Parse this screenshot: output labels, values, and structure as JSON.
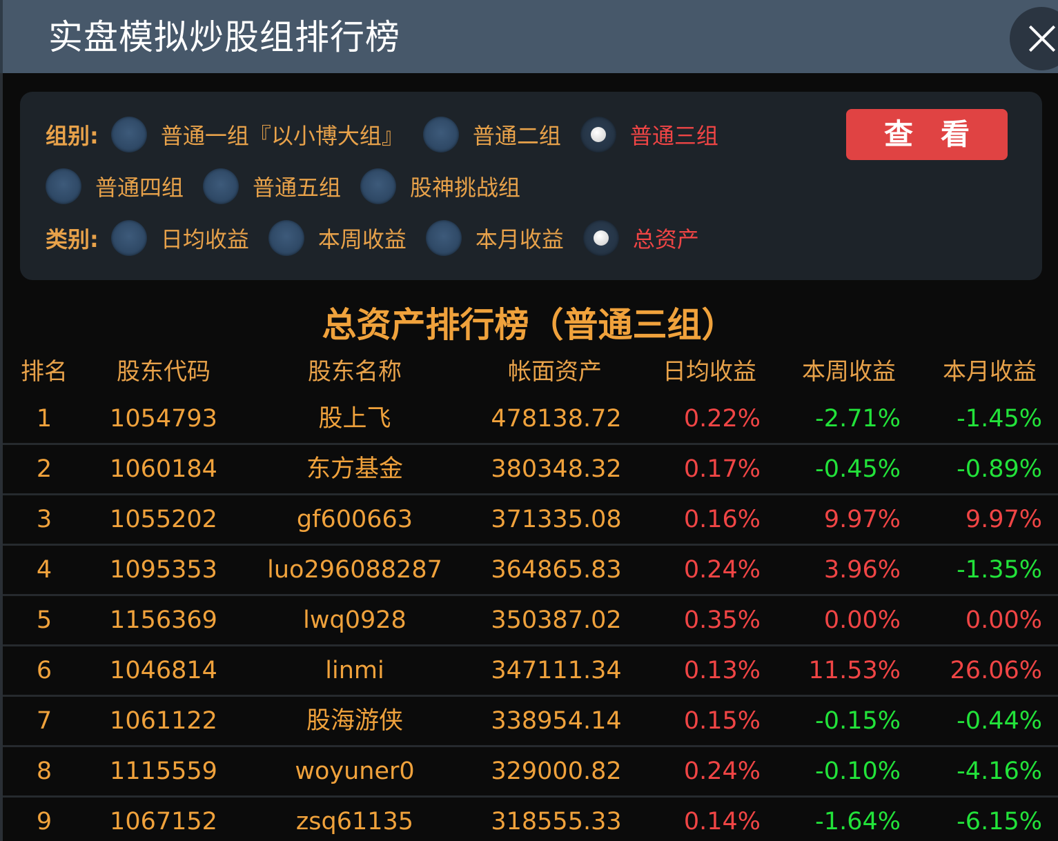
{
  "window": {
    "title": "实盘模拟炒股组排行榜"
  },
  "filters": {
    "group_label": "组别:",
    "groups": [
      {
        "label": "普通一组『以小博大组』",
        "checked": false
      },
      {
        "label": "普通二组",
        "checked": false
      },
      {
        "label": "普通三组",
        "checked": true
      },
      {
        "label": "普通四组",
        "checked": false
      },
      {
        "label": "普通五组",
        "checked": false
      },
      {
        "label": "股神挑战组",
        "checked": false
      }
    ],
    "category_label": "类别:",
    "categories": [
      {
        "label": "日均收益",
        "checked": false
      },
      {
        "label": "本周收益",
        "checked": false
      },
      {
        "label": "本月收益",
        "checked": false
      },
      {
        "label": "总资产",
        "checked": true
      }
    ],
    "view_button": "查看"
  },
  "ranking": {
    "title": "总资产排行榜（普通三组）",
    "columns": [
      "排名",
      "股东代码",
      "股东名称",
      "帐面资产",
      "日均收益",
      "本周收益",
      "本月收益"
    ],
    "rows": [
      {
        "rank": "1",
        "code": "1054793",
        "name": "股上飞",
        "assets": "478138.72",
        "daily": "0.22%",
        "weekly": "-2.71%",
        "monthly": "-1.45%"
      },
      {
        "rank": "2",
        "code": "1060184",
        "name": "东方基金",
        "assets": "380348.32",
        "daily": "0.17%",
        "weekly": "-0.45%",
        "monthly": "-0.89%"
      },
      {
        "rank": "3",
        "code": "1055202",
        "name": "gf600663",
        "assets": "371335.08",
        "daily": "0.16%",
        "weekly": "9.97%",
        "monthly": "9.97%"
      },
      {
        "rank": "4",
        "code": "1095353",
        "name": "luo296088287",
        "assets": "364865.83",
        "daily": "0.24%",
        "weekly": "3.96%",
        "monthly": "-1.35%"
      },
      {
        "rank": "5",
        "code": "1156369",
        "name": "lwq0928",
        "assets": "350387.02",
        "daily": "0.35%",
        "weekly": "0.00%",
        "monthly": "0.00%"
      },
      {
        "rank": "6",
        "code": "1046814",
        "name": "linmi",
        "assets": "347111.34",
        "daily": "0.13%",
        "weekly": "11.53%",
        "monthly": "26.06%"
      },
      {
        "rank": "7",
        "code": "1061122",
        "name": "股海游侠",
        "assets": "338954.14",
        "daily": "0.15%",
        "weekly": "-0.15%",
        "monthly": "-0.44%"
      },
      {
        "rank": "8",
        "code": "1115559",
        "name": "woyuner0",
        "assets": "329000.82",
        "daily": "0.24%",
        "weekly": "-0.10%",
        "monthly": "-4.16%"
      },
      {
        "rank": "9",
        "code": "1067152",
        "name": "zsq61135",
        "assets": "318555.33",
        "daily": "0.14%",
        "weekly": "-1.64%",
        "monthly": "-6.15%"
      }
    ]
  },
  "colors": {
    "accent": "#e8a24a",
    "positive": "#f04545",
    "negative": "#22e33a",
    "titlebar": "#47586a",
    "button": "#e04343"
  }
}
